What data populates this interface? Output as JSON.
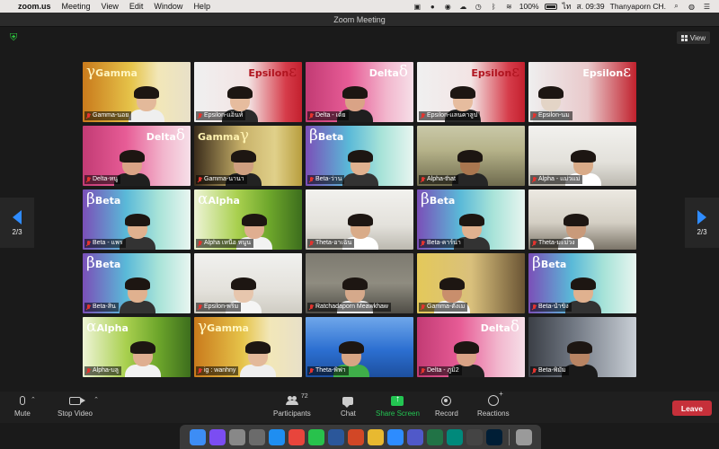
{
  "menubar": {
    "app_name": "zoom.us",
    "menus": [
      "Meeting",
      "View",
      "Edit",
      "Window",
      "Help"
    ],
    "battery": "100%",
    "lang": "ไท",
    "clock": "ส. 09:39",
    "user": "Thanyaporn CH."
  },
  "window": {
    "title": "Zoom Meeting"
  },
  "view_button": "View",
  "pager": {
    "left": "2/3",
    "right": "2/3"
  },
  "tiles": [
    {
      "name": "Gamma-นอย",
      "theme": "gamma",
      "brand": "Gamma",
      "greek": "γ"
    },
    {
      "name": "Epsilon-แอ็นท์",
      "theme": "epsilon",
      "brand": "Epsilon",
      "greek": "ε"
    },
    {
      "name": "Delta - เต้ย",
      "theme": "delta",
      "brand": "Delta",
      "greek": "δ"
    },
    {
      "name": "Epsilon-แลนคาลูป",
      "theme": "epsilon",
      "brand": "Epsilon",
      "greek": "ε"
    },
    {
      "name": "Epsilon-นม",
      "theme": "epsilon2",
      "brand": "Epsilon",
      "greek": "ε"
    },
    {
      "name": "Delta-หนู",
      "theme": "delta",
      "brand": "Delta",
      "greek": "δ"
    },
    {
      "name": "Gamma-นานา",
      "theme": "gamma2",
      "brand": "Gamma",
      "greek": "γ"
    },
    {
      "name": "Beta-ว่าน",
      "theme": "beta",
      "brand": "Beta",
      "greek": "β"
    },
    {
      "name": "Alpha-that",
      "theme": "room",
      "brand": "",
      "greek": ""
    },
    {
      "name": "Alpha - แม่วแม่",
      "theme": "dark",
      "brand": "",
      "greek": ""
    },
    {
      "name": "Beta - แพร",
      "theme": "beta",
      "brand": "Beta",
      "greek": "β"
    },
    {
      "name": "Alpha เหนือ หนูน",
      "theme": "alpha",
      "brand": "Alpha",
      "greek": "α"
    },
    {
      "name": "Theta-อาเฉิน",
      "theme": "dark",
      "brand": "",
      "greek": ""
    },
    {
      "name": "Beta-คาร์น่า",
      "theme": "beta",
      "brand": "Beta",
      "greek": "β"
    },
    {
      "name": "Theta-มะม่วง",
      "theme": "dark2",
      "brand": "",
      "greek": ""
    },
    {
      "name": "Beta-สิน",
      "theme": "beta",
      "brand": "Beta",
      "greek": "β"
    },
    {
      "name": "Epsilon-พริม",
      "theme": "room2",
      "brand": "",
      "greek": ""
    },
    {
      "name": "Ratchadaporn Meawkhaw",
      "theme": "room3",
      "brand": "",
      "greek": ""
    },
    {
      "name": "Gamma-ตั้งเม",
      "theme": "gamma3",
      "brand": "",
      "greek": ""
    },
    {
      "name": "Beta-น้ำขิง",
      "theme": "beta",
      "brand": "Beta",
      "greek": "β"
    },
    {
      "name": "Alpha-บลู",
      "theme": "alpha",
      "brand": "Alpha",
      "greek": "α"
    },
    {
      "name": "ig : wanhny",
      "theme": "gamma",
      "brand": "Gamma",
      "greek": "γ"
    },
    {
      "name": "Theta-พิฟา",
      "theme": "blue",
      "brand": "",
      "greek": ""
    },
    {
      "name": "Delta - ภูมิ2",
      "theme": "delta",
      "brand": "Delta",
      "greek": "δ"
    },
    {
      "name": "Beta-พิมัม",
      "theme": "room4",
      "brand": "",
      "greek": ""
    }
  ],
  "toolbar": {
    "mute": "Mute",
    "stop_video": "Stop Video",
    "participants": "Participants",
    "participant_count": "72",
    "chat": "Chat",
    "share_screen": "Share Screen",
    "record": "Record",
    "reactions": "Reactions",
    "leave": "Leave"
  },
  "dock_apps": [
    {
      "icon": "finder-icon",
      "color": "#3d8df5"
    },
    {
      "icon": "siri-icon",
      "color": "#7b4df2"
    },
    {
      "icon": "launchpad-icon",
      "color": "#888888"
    },
    {
      "icon": "system-preferences-icon",
      "color": "#6b6b6b"
    },
    {
      "icon": "app-store-icon",
      "color": "#1f8ef1"
    },
    {
      "icon": "chrome-icon",
      "color": "#e8453c"
    },
    {
      "icon": "line-icon",
      "color": "#28c24c"
    },
    {
      "icon": "word-icon",
      "color": "#2b579a"
    },
    {
      "icon": "powerpoint-icon",
      "color": "#d24726"
    },
    {
      "icon": "notes-icon",
      "color": "#e8b930"
    },
    {
      "icon": "zoom-icon",
      "color": "#2d8cff"
    },
    {
      "icon": "teams-icon",
      "color": "#5059c9"
    },
    {
      "icon": "excel-icon",
      "color": "#217346"
    },
    {
      "icon": "meet-icon",
      "color": "#00897b"
    },
    {
      "icon": "clock-icon",
      "color": "#444444"
    },
    {
      "icon": "photoshop-icon",
      "color": "#001e36"
    },
    {
      "icon": "trash-icon",
      "color": "#9a9a9a"
    }
  ]
}
